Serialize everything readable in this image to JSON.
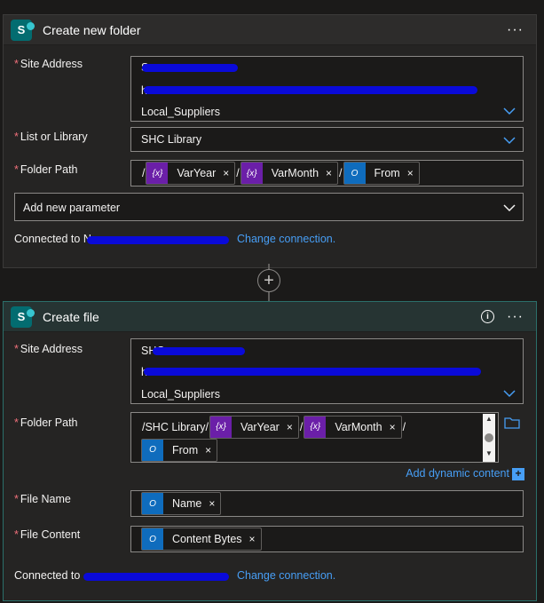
{
  "card1": {
    "title": "Create new folder",
    "more": "···",
    "site_address": {
      "label": "Site Address",
      "line1": "S",
      "line2": "h",
      "line3": "Local_Suppliers"
    },
    "list_or_library": {
      "label": "List or Library",
      "value": "SHC Library"
    },
    "folder_path": {
      "label": "Folder Path",
      "slash": "/",
      "tokens": [
        {
          "text": "VarYear",
          "icon": "{x}"
        },
        {
          "text": "VarMonth",
          "icon": "{x}"
        },
        {
          "text": "From",
          "icon": "O"
        }
      ]
    },
    "add_parameter": "Add new parameter",
    "connected_to": "Connected to",
    "connected_prefix": "N",
    "change_connection": "Change connection."
  },
  "connector_plus": "+",
  "card2": {
    "title": "Create file",
    "info": "i",
    "site_address": {
      "label": "Site Address",
      "line1": "SHC",
      "line2": "h",
      "line3": "Local_Suppliers"
    },
    "folder_path": {
      "label": "Folder Path",
      "prefix": "/SHC Library/",
      "slash": "/",
      "tokens": [
        {
          "text": "VarYear",
          "icon": "{x}"
        },
        {
          "text": "VarMonth",
          "icon": "{x}"
        },
        {
          "text": "From",
          "icon": "O"
        }
      ],
      "add_dynamic": "Add dynamic content",
      "add_dynamic_plus": "+"
    },
    "file_name": {
      "label": "File Name",
      "token": "Name",
      "icon": "O"
    },
    "file_content": {
      "label": "File Content",
      "token": "Content Bytes",
      "icon": "O"
    },
    "connected_to": "Connected to",
    "change_connection": "Change connection."
  },
  "close_glyph": "×",
  "required_mark": "*",
  "colors": {
    "accent": "#479ef5",
    "variable": "#6b1fa8",
    "outlook": "#0f6cbd",
    "redaction": "#0a0ad9",
    "required": "#f1707b"
  }
}
